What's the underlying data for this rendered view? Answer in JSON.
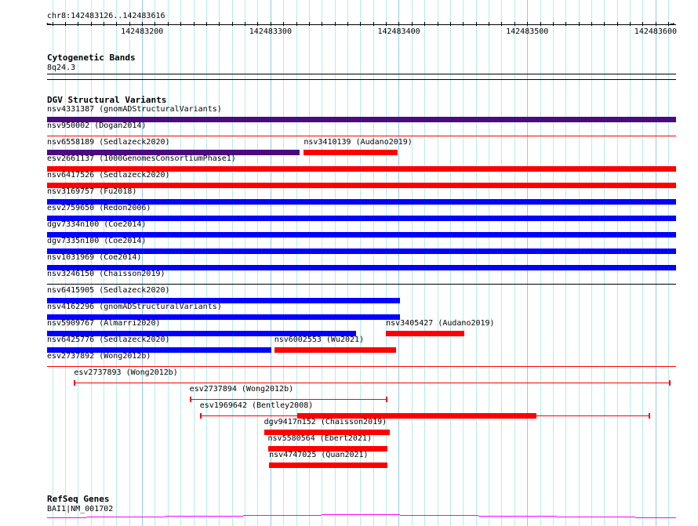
{
  "ruler": {
    "region": "chr8:142483126..142483616",
    "start": 142483126,
    "end": 142483616,
    "labels": [
      "142483200",
      "142483300",
      "142483400",
      "142483500",
      "142483600"
    ]
  },
  "cyto": {
    "title": "Cytogenetic Bands",
    "band": "8q24.3"
  },
  "dgv": {
    "title": "DGV Structural Variants",
    "colors": {
      "purple": "#4b0a82",
      "red": "#ff0000",
      "blue": "#0000ff",
      "black": "#000000"
    },
    "rows": [
      [
        {
          "label": "nsv4331387 (gnomADStructuralVariants)",
          "start": 142483126,
          "end": 142483616,
          "color": "#4b0a82",
          "style": "thick"
        }
      ],
      [
        {
          "label": "nsv950002 (Dogan2014)",
          "start": 142483126,
          "end": 142483616,
          "color": "#ff0000",
          "style": "line"
        }
      ],
      [
        {
          "label": "nsv6558189 (Sedlazeck2020)",
          "start": 142483126,
          "end": 142483323,
          "color": "#4b0a82",
          "style": "thick"
        },
        {
          "label": "nsv3410139 (Audano2019)",
          "start": 142483326,
          "end": 142483399,
          "color": "#ff0000",
          "style": "thick"
        }
      ],
      [
        {
          "label": "esv2661137 (1000GenomesConsortiumPhase1)",
          "start": 142483126,
          "end": 142483616,
          "color": "#ff0000",
          "style": "thick"
        }
      ],
      [
        {
          "label": "nsv6417526 (Sedlazeck2020)",
          "start": 142483126,
          "end": 142483616,
          "color": "#ff0000",
          "style": "thick"
        }
      ],
      [
        {
          "label": "nsv3169757 (Fu2018)",
          "start": 142483126,
          "end": 142483616,
          "color": "#0000ff",
          "style": "thick"
        }
      ],
      [
        {
          "label": "esv2759650 (Redon2006)",
          "start": 142483126,
          "end": 142483616,
          "color": "#0000ff",
          "style": "thick"
        }
      ],
      [
        {
          "label": "dgv7334n100 (Coe2014)",
          "start": 142483126,
          "end": 142483616,
          "color": "#0000ff",
          "style": "thick"
        }
      ],
      [
        {
          "label": "dgv7335n100 (Coe2014)",
          "start": 142483126,
          "end": 142483616,
          "color": "#0000ff",
          "style": "thick"
        }
      ],
      [
        {
          "label": "nsv1031969 (Coe2014)",
          "start": 142483126,
          "end": 142483616,
          "color": "#0000ff",
          "style": "thick"
        }
      ],
      [
        {
          "label": "nsv3246150 (Chaisson2019)",
          "start": 142483126,
          "end": 142483616,
          "color": "#000000",
          "style": "line"
        }
      ],
      [
        {
          "label": "nsv6415905 (Sedlazeck2020)",
          "start": 142483126,
          "end": 142483401,
          "color": "#0000ff",
          "style": "thick"
        }
      ],
      [
        {
          "label": "nsv4162296 (gnomADStructuralVariants)",
          "start": 142483126,
          "end": 142483401,
          "color": "#0000ff",
          "style": "thick"
        }
      ],
      [
        {
          "label": "nsv5909767 (Almarri2020)",
          "start": 142483126,
          "end": 142483367,
          "color": "#0000ff",
          "style": "thick"
        },
        {
          "label": "nsv3405427 (Audano2019)",
          "start": 142483390,
          "end": 142483451,
          "color": "#ff0000",
          "style": "thick"
        }
      ],
      [
        {
          "label": "nsv6425776 (Sedlazeck2020)",
          "start": 142483126,
          "end": 142483301,
          "color": "#0000ff",
          "style": "thick"
        },
        {
          "label": "nsv6002553 (Wu2021)",
          "start": 142483303,
          "end": 142483398,
          "color": "#ff0000",
          "style": "thick"
        }
      ],
      [
        {
          "label": "esv2737892 (Wong2012b)",
          "start": 142483126,
          "end": 142483616,
          "color": "#ff0000",
          "style": "line"
        }
      ],
      [
        {
          "label": "esv2737893 (Wong2012b)",
          "start": 142483147,
          "end": 142483612,
          "color": "#ff0000",
          "style": "capped"
        }
      ],
      [
        {
          "label": "esv2737894 (Wong2012b)",
          "start": 142483237,
          "end": 142483391,
          "color": "#ff0000",
          "style": "capped"
        }
      ],
      [
        {
          "label": "esv1969642 (Bentley2008)",
          "start": 142483245,
          "end": 142483596,
          "thickStart": 142483321,
          "thickEnd": 142483507,
          "color": "#ff0000",
          "style": "capped"
        }
      ],
      [
        {
          "label": "dgv9417n152 (Chaisson2019)",
          "start": 142483295,
          "end": 142483393,
          "color": "#ff0000",
          "style": "thick"
        }
      ],
      [
        {
          "label": "nsv5580564 (Ebert2021)",
          "start": 142483298,
          "end": 142483391,
          "color": "#ff0000",
          "style": "thick"
        }
      ],
      [
        {
          "label": "nsv4747025 (Quan2021)",
          "start": 142483299,
          "end": 142483391,
          "color": "#ff0000",
          "style": "thick"
        }
      ]
    ]
  },
  "refseq": {
    "title": "RefSeq Genes",
    "gene": "BAI1|NM_001702",
    "color": "#ff00ff"
  }
}
